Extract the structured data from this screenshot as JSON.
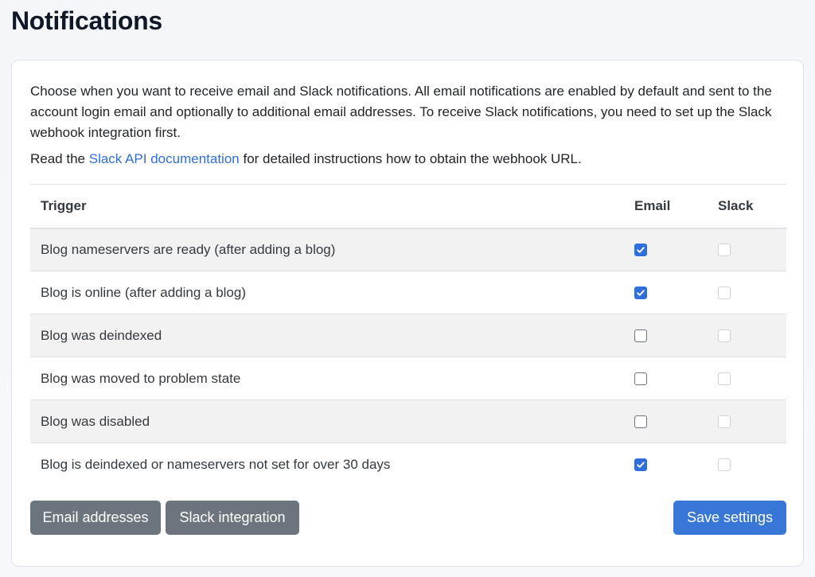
{
  "page": {
    "title": "Notifications"
  },
  "intro": {
    "paragraph": "Choose when you want to receive email and Slack notifications. All email notifications are enabled by default and sent to the account login email and optionally to additional email addresses. To receive Slack notifications, you need to set up the Slack webhook integration first.",
    "read_prefix": "Read the",
    "link_text": "Slack API documentation",
    "read_suffix": "for detailed instructions how to obtain the webhook URL."
  },
  "table": {
    "headers": {
      "trigger": "Trigger",
      "email": "Email",
      "slack": "Slack"
    },
    "rows": [
      {
        "trigger": "Blog nameservers are ready (after adding a blog)",
        "email": true,
        "slack": false
      },
      {
        "trigger": "Blog is online (after adding a blog)",
        "email": true,
        "slack": false
      },
      {
        "trigger": "Blog was deindexed",
        "email": false,
        "slack": false
      },
      {
        "trigger": "Blog was moved to problem state",
        "email": false,
        "slack": false
      },
      {
        "trigger": "Blog was disabled",
        "email": false,
        "slack": false
      },
      {
        "trigger": "Blog is deindexed or nameservers not set for over 30 days",
        "email": true,
        "slack": false
      }
    ]
  },
  "buttons": {
    "email_addresses": "Email addresses",
    "slack_integration": "Slack integration",
    "save_settings": "Save settings"
  },
  "colors": {
    "accent": "#2f6fdb",
    "secondary": "#6c757d"
  }
}
